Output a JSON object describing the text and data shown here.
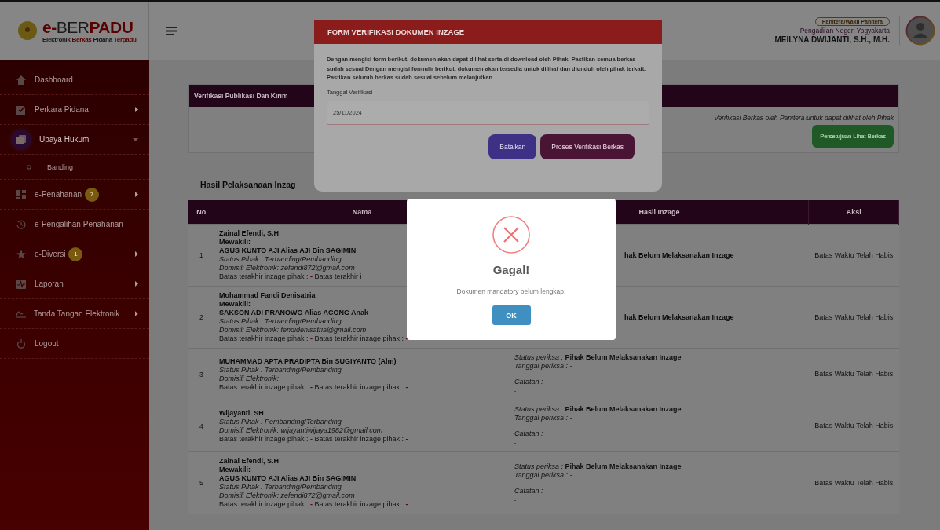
{
  "header": {
    "logo": {
      "title_parts": [
        {
          "text": "e-",
          "color": "#5a0000"
        },
        {
          "text": "BER",
          "color": "#1a1a1a"
        },
        {
          "text": "PADU",
          "color": "#5a0000"
        }
      ],
      "subtitle_parts": [
        {
          "text": "Elektronik",
          "color": "#1a1a1a"
        },
        {
          "text": "Berkas",
          "color": "#5a0000"
        },
        {
          "text": "Pidana",
          "color": "#1a1a1a"
        },
        {
          "text": "Terpadu",
          "color": "#5a0000"
        }
      ]
    },
    "role_badge": "Panitera/Wakil Panitera",
    "court": "Pengadilan Negeri Yogyakarta",
    "user_name": "MEILYNA DWIJANTI, S.H., M.H."
  },
  "sidebar": {
    "items": [
      {
        "label": "Dashboard",
        "kind": "item",
        "selected": false
      },
      {
        "label": "Perkara Pidana",
        "kind": "item",
        "selected": false,
        "submenu": true,
        "expanded": false
      },
      {
        "label": "Upaya Hukum",
        "kind": "item",
        "selected": true,
        "submenu": true,
        "expanded": true
      },
      {
        "label": "Banding",
        "kind": "subitem",
        "selected": false
      },
      {
        "label": "e-Penahanan",
        "kind": "item",
        "selected": false,
        "submenu": true,
        "expanded": false,
        "badge": "7"
      },
      {
        "label": "e-Pengalihan Penahanan",
        "kind": "item",
        "selected": false
      },
      {
        "label": "e-Diversi",
        "kind": "item",
        "selected": false,
        "submenu": true,
        "expanded": false,
        "badge": "1"
      },
      {
        "label": "Laporan",
        "kind": "item",
        "selected": false,
        "submenu": true,
        "expanded": false
      },
      {
        "label": "Tanda Tangan Elektronik",
        "kind": "item",
        "selected": false,
        "submenu": true,
        "expanded": false
      },
      {
        "label": "Logout",
        "kind": "item",
        "selected": false
      }
    ]
  },
  "card": {
    "title": "Verifikasi Publikasi Dan Kirim",
    "note": "Verifikasi Berkas oleh Panitera untuk dapat dilihat oleh Pihak",
    "button": "Persetujuan Lihat Berkas"
  },
  "results": {
    "title": "Hasil Pelaksanaan Inzag",
    "columns": [
      "No",
      "Nama",
      "Hasil Inzage",
      "Aksi"
    ],
    "rows": [
      {
        "no": "1",
        "party": [
          {
            "kind": "bold",
            "text": "Zainal Efendi, S.H"
          },
          {
            "kind": "bold",
            "text": "Mewakili:"
          },
          {
            "kind": "bold",
            "text": "AGUS KUNTO AJI Alias AJI Bin SAGIMIN"
          },
          {
            "kind": "italic",
            "text": "Status Pihak : Terbanding/Pembanding"
          },
          {
            "kind": "italic",
            "text": "Domisili Elektronik: zefendi872@gmail.com"
          },
          {
            "kind": "deadline",
            "parts": [
              {
                "label": "Batas terakhir inzage pihak :",
                "value": "-"
              },
              {
                "label": "Batas terakhir i"
              }
            ]
          }
        ],
        "result": {
          "kind": "covered",
          "text": "hak Belum Melaksanakan Inzage"
        },
        "action": "Batas Waktu Telah Habis"
      },
      {
        "no": "2",
        "party": [
          {
            "kind": "bold",
            "text": "Mohammad Fandi Denisatria"
          },
          {
            "kind": "bold",
            "text": "Mewakili:"
          },
          {
            "kind": "bold",
            "text": "SAKSON ADI PRANOWO Alias ACONG Anak"
          },
          {
            "kind": "italic",
            "text": "Status Pihak : Terbanding/Pembanding"
          },
          {
            "kind": "italic",
            "text": "Domisili Elektronik: fendidenisatria@gmail.com"
          },
          {
            "kind": "deadline",
            "parts": [
              {
                "label": "Batas terakhir inzage pihak :",
                "value": "-"
              },
              {
                "label": "Batas terakhir inzage pihak :",
                "value": "-"
              }
            ]
          }
        ],
        "result": {
          "kind": "covered",
          "text": "hak Belum Melaksanakan Inzage"
        },
        "action": "Batas Waktu Telah Habis"
      },
      {
        "no": "3",
        "party": [
          {
            "kind": "bold",
            "text": "MUHAMMAD APTA PRADIPTA Bin SUGIYANTO (Alm)"
          },
          {
            "kind": "italic",
            "text": "Status Pihak : Terbanding/Pembanding"
          },
          {
            "kind": "italic",
            "text": "Domisili Elektronik:"
          },
          {
            "kind": "deadline",
            "parts": [
              {
                "label": "Batas terakhir inzage pihak :",
                "value": "-"
              },
              {
                "label": "Batas terakhir inzage pihak :",
                "value": "-"
              }
            ]
          }
        ],
        "result": {
          "kind": "full",
          "status_label": "Status periksa :",
          "status": "Pihak Belum Melaksanakan Inzage",
          "date_label": "Tanggal periksa :",
          "date": "-",
          "note_label": "Catatan :",
          "note": "-"
        },
        "action": "Batas Waktu Telah Habis"
      },
      {
        "no": "4",
        "party": [
          {
            "kind": "bold",
            "text": "Wijayanti, SH"
          },
          {
            "kind": "italic",
            "text": "Status Pihak : Pembanding/Terbanding"
          },
          {
            "kind": "italic",
            "text": "Domisili Elektronik: wijayantiwijaya1982@gmail.com"
          },
          {
            "kind": "deadline",
            "parts": [
              {
                "label": "Batas terakhir inzage pihak :",
                "value": "-"
              },
              {
                "label": "Batas terakhir inzage pihak :",
                "value": "-"
              }
            ]
          }
        ],
        "result": {
          "kind": "full",
          "status_label": "Status periksa :",
          "status": "Pihak Belum Melaksanakan Inzage",
          "date_label": "Tanggal periksa :",
          "date": "-",
          "note_label": "Catatan :",
          "note": "-"
        },
        "action": "Batas Waktu Telah Habis"
      },
      {
        "no": "5",
        "party": [
          {
            "kind": "bold",
            "text": "Zainal Efendi, S.H"
          },
          {
            "kind": "bold",
            "text": "Mewakili:"
          },
          {
            "kind": "bold",
            "text": "AGUS KUNTO AJI Alias AJI Bin SAGIMIN"
          },
          {
            "kind": "italic",
            "text": "Status Pihak : Terbanding/Pembanding"
          },
          {
            "kind": "italic",
            "text": "Domisili Elektronik: zefendi872@gmail.com"
          },
          {
            "kind": "deadline",
            "parts": [
              {
                "label": "Batas terakhir inzage pihak :",
                "value": "-"
              },
              {
                "label": "Batas terakhir inzage pihak :",
                "value": "-"
              }
            ]
          }
        ],
        "result": {
          "kind": "full",
          "status_label": "Status periksa :",
          "status": "Pihak Belum Melaksanakan Inzage",
          "date_label": "Tanggal periksa :",
          "date": "-",
          "note_label": "Catatan :",
          "note": "-"
        },
        "action": "Batas Waktu Telah Habis"
      }
    ]
  },
  "form_dialog": {
    "title": "FORM VERIFIKASI DOKUMEN INZAGE",
    "description": "Dengan mengisi form berikut, dokumen akan dapat dilihat serta di download oleh Pihak. Pastikan semua berkas sudah sesuai Dengan mengisi formulir berikut, dokumen akan tersedia untuk dilihat dan diunduh oleh pihak terkait. Pastikan seluruh berkas sudah sesuai sebelum melanjutkan.",
    "date_label": "Tanggal Verifikasi",
    "date_value": "25/11/2024",
    "buttons": [
      {
        "label": "Batalkan",
        "kind": "cancel"
      },
      {
        "label": "Proses Verifikasi Berkas",
        "kind": "submit"
      }
    ]
  },
  "alert": {
    "title": "Gagal!",
    "message": "Dokumen mandatory belum lengkap.",
    "button": "OK"
  }
}
